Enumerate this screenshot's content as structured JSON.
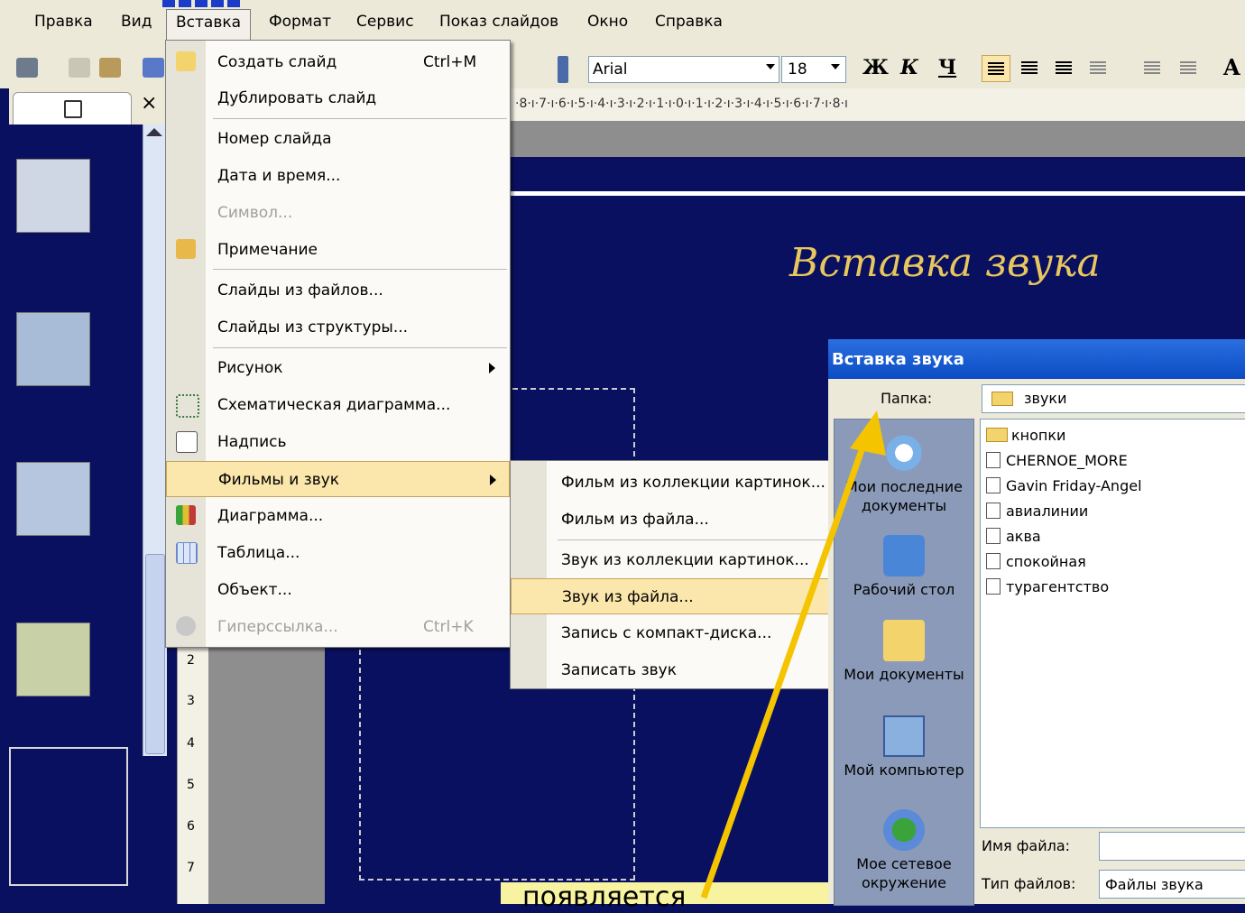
{
  "menubar": {
    "items": [
      "Правка",
      "Вид",
      "Вставка",
      "Формат",
      "Сервис",
      "Показ слайдов",
      "Окно",
      "Справка"
    ],
    "active": "Вставка"
  },
  "toolbar": {
    "font_name": "Arial",
    "font_size": "18",
    "bold": "Ж",
    "italic": "К",
    "underline": "Ч",
    "font_size_big": "A"
  },
  "ruler": {
    "horizontal": "·8·ı·7·ı·6·ı·5·ı·4·ı·3·ı·2·ı·1·ı·0·ı·1·ı·2·ı·3·ı·4·ı·5·ı·6·ı·7·ı·8·ı",
    "vertical": [
      "2",
      "3",
      "4",
      "5",
      "6",
      "7"
    ]
  },
  "panel": {
    "close": "×"
  },
  "insert_menu": {
    "items": [
      {
        "label": "Создать слайд",
        "shortcut": "Ctrl+M"
      },
      {
        "label": "Дублировать слайд",
        "shortcut": ""
      },
      {
        "label": "Номер слайда",
        "shortcut": ""
      },
      {
        "label": "Дата и время...",
        "shortcut": ""
      },
      {
        "label": "Символ...",
        "shortcut": ""
      },
      {
        "label": "Примечание",
        "shortcut": ""
      },
      {
        "label": "Слайды из файлов...",
        "shortcut": ""
      },
      {
        "label": "Слайды из структуры...",
        "shortcut": ""
      },
      {
        "label": "Рисунок",
        "shortcut": ""
      },
      {
        "label": "Схематическая диаграмма...",
        "shortcut": ""
      },
      {
        "label": "Надпись",
        "shortcut": ""
      },
      {
        "label": "Фильмы и звук",
        "shortcut": ""
      },
      {
        "label": "Диаграмма...",
        "shortcut": ""
      },
      {
        "label": "Таблица...",
        "shortcut": ""
      },
      {
        "label": "Объект...",
        "shortcut": ""
      },
      {
        "label": "Гиперссылка...",
        "shortcut": "Ctrl+K"
      }
    ]
  },
  "movies_submenu": {
    "items": [
      "Фильм из коллекции картинок...",
      "Фильм из файла...",
      "Звук из коллекции картинок...",
      "Звук из файла...",
      "Запись с компакт-диска...",
      "Записать звук"
    ]
  },
  "slide": {
    "title": "Вставка звука",
    "callout": "появляется"
  },
  "dialog": {
    "title": "Вставка звука",
    "folder_label": "Папка:",
    "folder_value": "звуки",
    "places": [
      "Мои последние документы",
      "Рабочий стол",
      "Мои документы",
      "Мой компьютер",
      "Мое сетевое окружение"
    ],
    "files": [
      "кнопки",
      "CHERNOE_MORE",
      "Gavin Friday-Angel",
      "авиалинии",
      "аква",
      "спокойная",
      "турагентство"
    ],
    "filename_label": "Имя файла:",
    "filetype_label": "Тип файлов:",
    "filetype_value": "Файлы звука"
  },
  "colors": {
    "slide_bg": "#0a1060",
    "title_gold": "#e8c75e",
    "highlight": "#fbe6ab",
    "arrow": "#f5c400"
  }
}
